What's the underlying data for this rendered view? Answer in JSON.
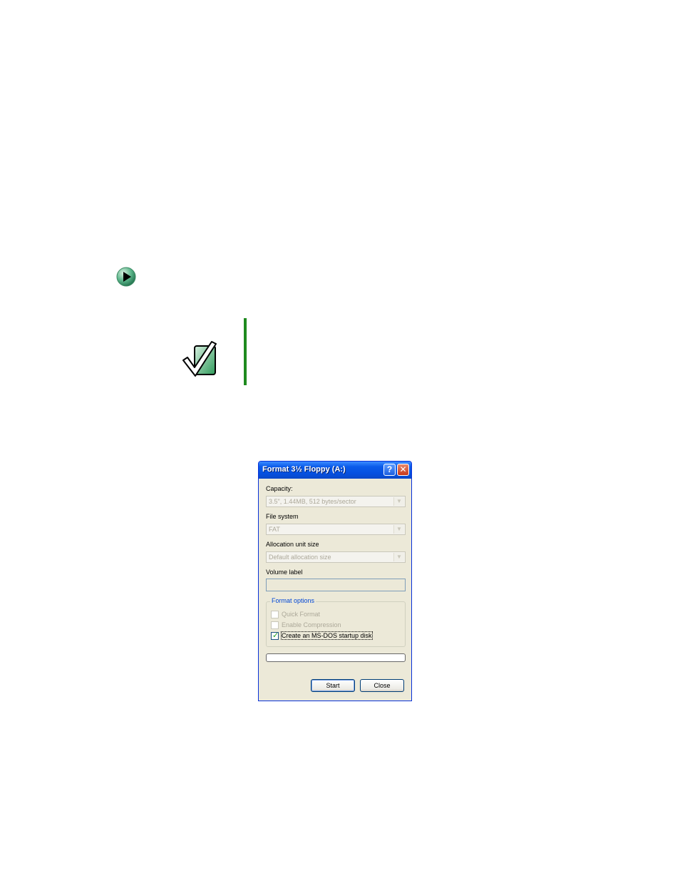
{
  "colors": {
    "accent_green": "#1f8a1f",
    "titlebar_blue": "#0a5bea",
    "dialog_face": "#ece9d8",
    "group_title_blue": "#0046d5"
  },
  "icons": {
    "bullet": "arrow-right-icon",
    "important": "checkmark-note-icon",
    "help": "help-icon",
    "close": "close-icon",
    "dropdown": "chevron-down-icon"
  },
  "dialog": {
    "title": "Format 3½ Floppy (A:)",
    "help_glyph": "?",
    "close_glyph": "✕",
    "capacity": {
      "label": "Capacity:",
      "value": "3.5\", 1.44MB, 512 bytes/sector"
    },
    "file_system": {
      "label": "File system",
      "value": "FAT"
    },
    "allocation": {
      "label": "Allocation unit size",
      "value": "Default allocation size"
    },
    "volume_label": {
      "label": "Volume label",
      "value": ""
    },
    "format_options": {
      "title": "Format options",
      "options": [
        {
          "label": "Quick Format",
          "checked": false,
          "enabled": false
        },
        {
          "label": "Enable Compression",
          "checked": false,
          "enabled": false
        },
        {
          "label": "Create an MS-DOS startup disk",
          "checked": true,
          "enabled": true
        }
      ]
    },
    "progress": 0,
    "buttons": {
      "start": "Start",
      "close": "Close"
    }
  }
}
